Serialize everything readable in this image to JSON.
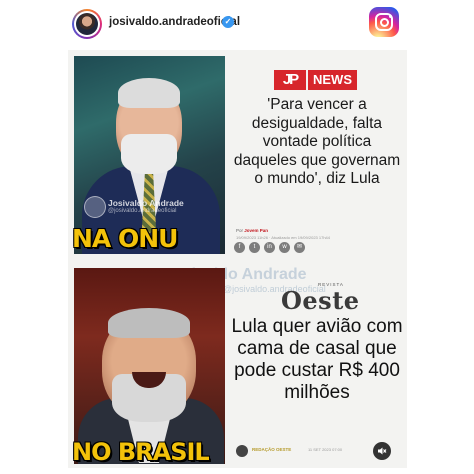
{
  "header": {
    "username": "josivaldo.andradeoficial",
    "verified_glyph": "✓",
    "avatar_icon": "profile-avatar",
    "app_icon": "instagram-icon"
  },
  "panel_top": {
    "watermark_name": "Josivaldo Andrade",
    "watermark_handle": "@josivaldo.andradeoficial",
    "caption": "NA ONU",
    "source_mark": "JP",
    "source_label": "NEWS",
    "headline": "'Para vencer a desigualdade, falta vontade política daqueles que governam o mundo', diz Lula",
    "byline_prefix": "Por",
    "byline_name": "Jovem Pan",
    "date_line": "19/09/2023 11h26 · Atualizado em 19/09/2023 17h44",
    "social_icons": [
      "f",
      "t",
      "in",
      "w",
      "✉"
    ]
  },
  "watermark_middle": {
    "name": "Josivaldo Andrade",
    "handle": "@josivaldo.andradeoficial"
  },
  "panel_bottom": {
    "caption": "NO BRASIL",
    "source_kicker": "REVISTA",
    "source_label": "Oeste",
    "headline": "Lula quer avião com cama de casal que pode custar R$ 400 milhões",
    "byline": "REDAÇÃO OESTE",
    "date_line": "11 SET 2023 07:00",
    "mute_icon": "speaker-muted-icon"
  },
  "colors": {
    "caption_yellow": "#f3c20a",
    "jp_red": "#d7262c",
    "verified_blue": "#3897f0"
  }
}
